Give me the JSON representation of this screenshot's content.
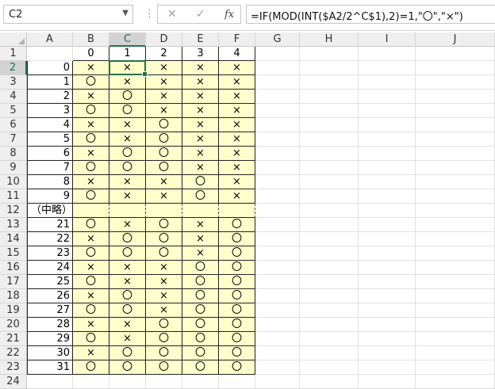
{
  "formula_bar": {
    "name_box": "C2",
    "cancel_symbol": "✕",
    "enter_symbol": "✓",
    "fx_symbol": "fx",
    "formula": "=IF(MOD(INT($A2/2^C$1),2)=1,\"〇\",\"×\")"
  },
  "columns": [
    "A",
    "B",
    "C",
    "D",
    "E",
    "F",
    "G",
    "H",
    "I",
    "J"
  ],
  "rows": [
    "1",
    "2",
    "3",
    "4",
    "5",
    "6",
    "7",
    "8",
    "9",
    "10",
    "11",
    "12",
    "13",
    "14",
    "15",
    "16",
    "17",
    "18",
    "19",
    "20",
    "21",
    "22",
    "23",
    "24"
  ],
  "selected_cell": "C2",
  "colors": {
    "fill": "#ffffcc",
    "accent": "#217346"
  },
  "sheet": {
    "header_row": [
      "0",
      "1",
      "2",
      "3",
      "4"
    ],
    "data": [
      {
        "a": "0",
        "v": [
          "×",
          "×",
          "×",
          "×",
          "×"
        ]
      },
      {
        "a": "1",
        "v": [
          "〇",
          "×",
          "×",
          "×",
          "×"
        ]
      },
      {
        "a": "2",
        "v": [
          "×",
          "〇",
          "×",
          "×",
          "×"
        ]
      },
      {
        "a": "3",
        "v": [
          "〇",
          "〇",
          "×",
          "×",
          "×"
        ]
      },
      {
        "a": "4",
        "v": [
          "×",
          "×",
          "〇",
          "×",
          "×"
        ]
      },
      {
        "a": "5",
        "v": [
          "〇",
          "×",
          "〇",
          "×",
          "×"
        ]
      },
      {
        "a": "6",
        "v": [
          "×",
          "〇",
          "〇",
          "×",
          "×"
        ]
      },
      {
        "a": "7",
        "v": [
          "〇",
          "〇",
          "〇",
          "×",
          "×"
        ]
      },
      {
        "a": "8",
        "v": [
          "×",
          "×",
          "×",
          "〇",
          "×"
        ]
      },
      {
        "a": "9",
        "v": [
          "〇",
          "×",
          "×",
          "〇",
          "×"
        ]
      },
      {
        "a": "（中略）",
        "v": [
          "",
          "",
          "",
          "",
          ""
        ]
      },
      {
        "a": "21",
        "v": [
          "〇",
          "×",
          "〇",
          "×",
          "〇"
        ]
      },
      {
        "a": "22",
        "v": [
          "×",
          "〇",
          "〇",
          "×",
          "〇"
        ]
      },
      {
        "a": "23",
        "v": [
          "〇",
          "〇",
          "〇",
          "×",
          "〇"
        ]
      },
      {
        "a": "24",
        "v": [
          "×",
          "×",
          "×",
          "〇",
          "〇"
        ]
      },
      {
        "a": "25",
        "v": [
          "〇",
          "×",
          "×",
          "〇",
          "〇"
        ]
      },
      {
        "a": "26",
        "v": [
          "×",
          "〇",
          "×",
          "〇",
          "〇"
        ]
      },
      {
        "a": "27",
        "v": [
          "〇",
          "〇",
          "×",
          "〇",
          "〇"
        ]
      },
      {
        "a": "28",
        "v": [
          "×",
          "×",
          "〇",
          "〇",
          "〇"
        ]
      },
      {
        "a": "29",
        "v": [
          "〇",
          "×",
          "〇",
          "〇",
          "〇"
        ]
      },
      {
        "a": "30",
        "v": [
          "×",
          "〇",
          "〇",
          "〇",
          "〇"
        ]
      },
      {
        "a": "31",
        "v": [
          "〇",
          "〇",
          "〇",
          "〇",
          "〇"
        ]
      }
    ]
  }
}
